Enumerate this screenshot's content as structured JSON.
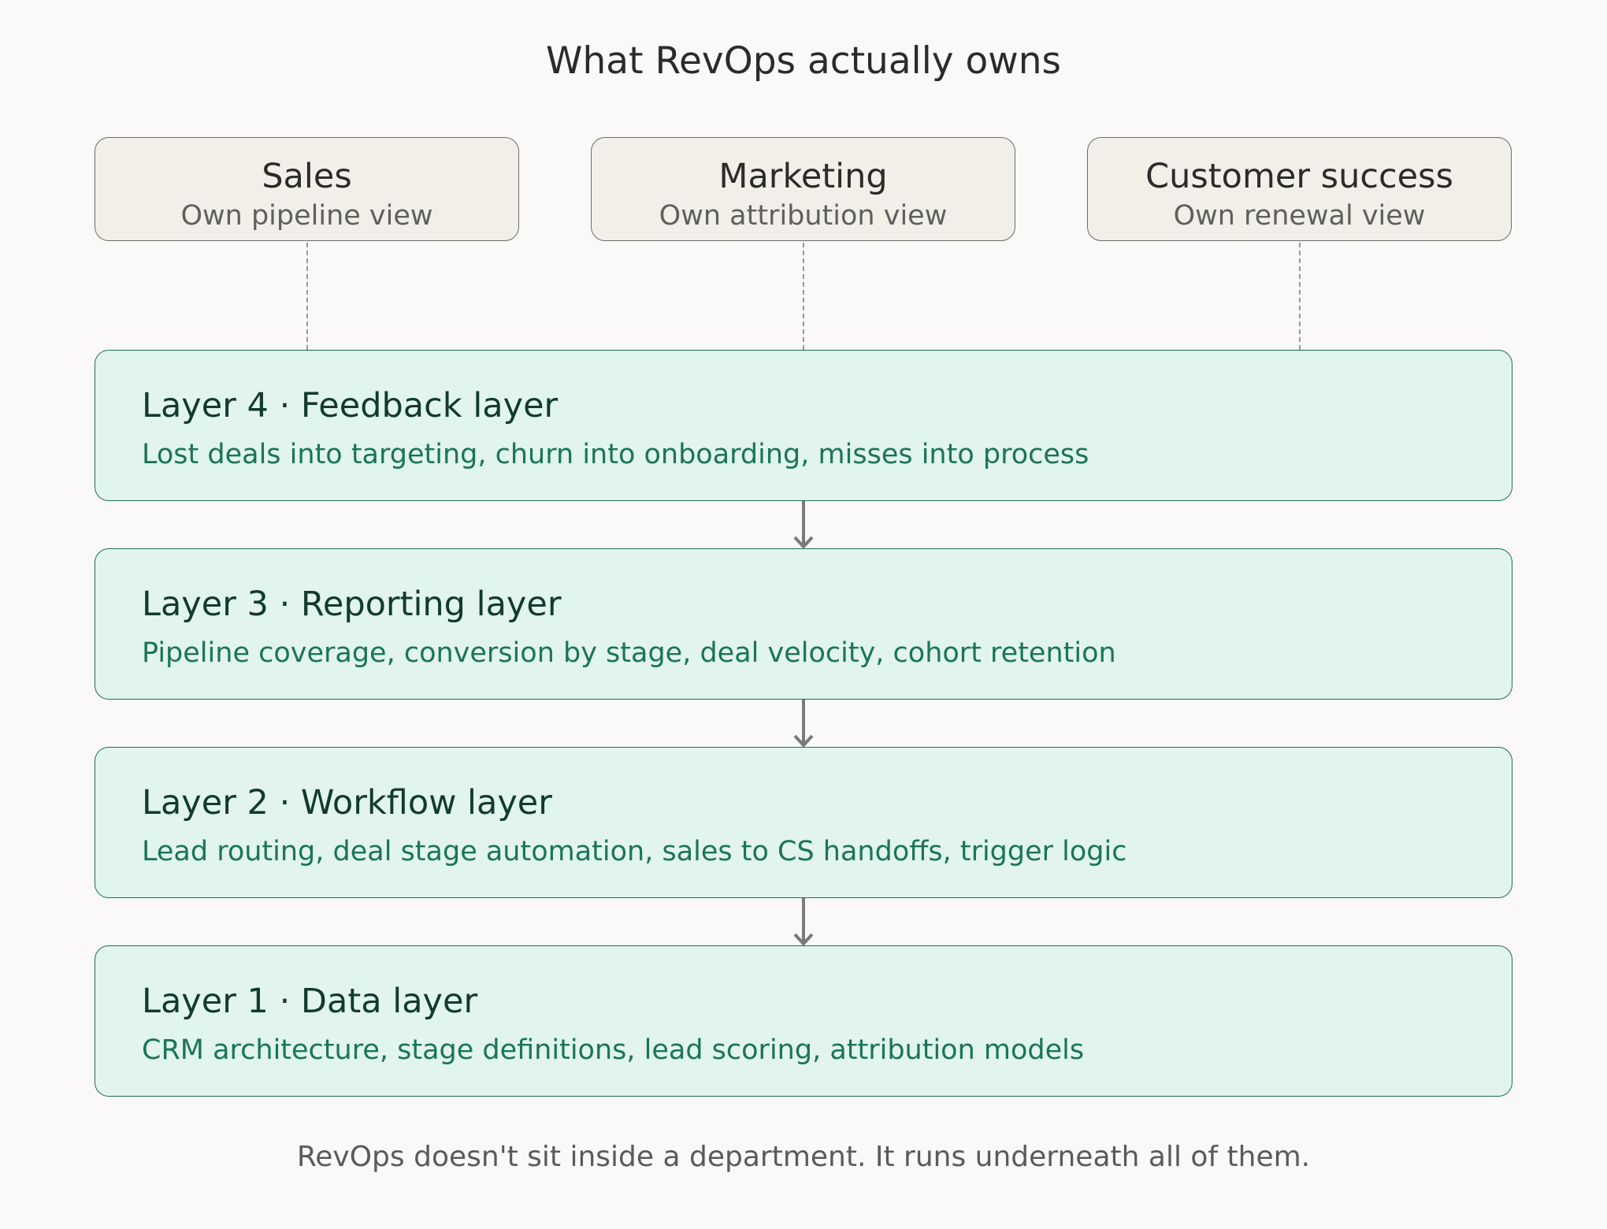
{
  "title": "What RevOps actually owns",
  "departments": [
    {
      "name": "Sales",
      "view": "Own pipeline view"
    },
    {
      "name": "Marketing",
      "view": "Own attribution view"
    },
    {
      "name": "Customer success",
      "view": "Own renewal view"
    }
  ],
  "layers": [
    {
      "name": "Layer 4 · Feedback layer",
      "description": "Lost deals into targeting, churn into onboarding, misses into process"
    },
    {
      "name": "Layer 3 · Reporting layer",
      "description": "Pipeline coverage, conversion by stage, deal velocity, cohort retention"
    },
    {
      "name": "Layer 2 · Workflow layer",
      "description": "Lead routing, deal stage automation, sales to CS handoffs, trigger logic"
    },
    {
      "name": "Layer 1 · Data layer",
      "description": "CRM architecture, stage definitions, lead scoring, attribution models"
    }
  ],
  "footer": "RevOps doesn't sit inside a department. It runs underneath all of them.",
  "colors": {
    "background": "#faf9f7",
    "department_fill": "#f2efe9",
    "layer_fill": "#e1f4ed",
    "layer_border": "#1f6f55",
    "layer_description": "#1a7556",
    "arrow": "#7a7a7a"
  }
}
